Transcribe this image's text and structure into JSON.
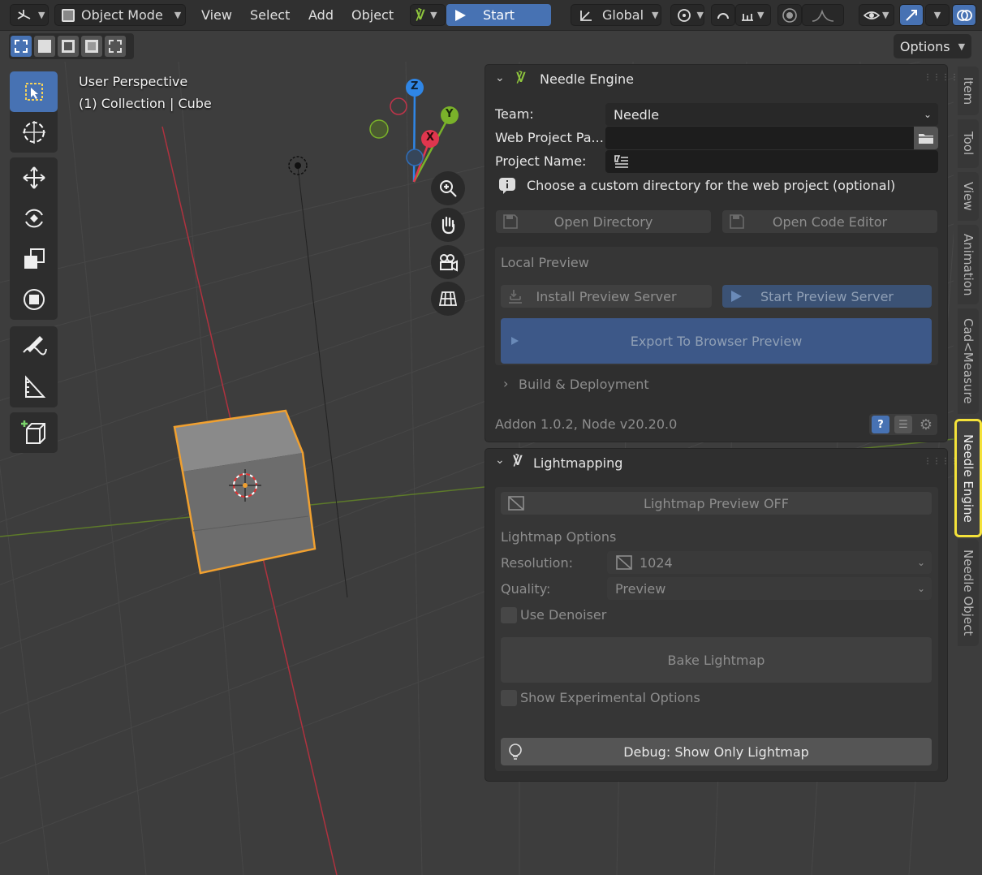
{
  "header": {
    "editor_type_icon": "3d-viewport-icon",
    "mode": "Object Mode",
    "menus": [
      "View",
      "Select",
      "Add",
      "Object"
    ],
    "start_label": "Start",
    "transform_orientation": "Global",
    "options_label": "Options"
  },
  "viewport": {
    "perspective": "User Perspective",
    "collection": "(1) Collection | Cube",
    "axes": {
      "z": "Z",
      "y": "Y",
      "x": "X"
    }
  },
  "needle_engine": {
    "title": "Needle Engine",
    "team_label": "Team:",
    "team_value": "Needle",
    "web_project_label": "Web Project Pa...",
    "web_project_value": "",
    "project_name_label": "Project Name:",
    "project_name_value": "",
    "hint": "Choose a custom directory for the web project (optional)",
    "open_directory": "Open Directory",
    "open_code_editor": "Open Code Editor",
    "local_preview_title": "Local Preview",
    "install_preview_server": "Install Preview Server",
    "start_preview_server": "Start Preview Server",
    "export_to_browser": "Export To Browser Preview",
    "build_deployment": "Build & Deployment",
    "version": "Addon 1.0.2, Node v20.20.0"
  },
  "lightmapping": {
    "title": "Lightmapping",
    "preview_toggle": "Lightmap Preview OFF",
    "options_title": "Lightmap Options",
    "resolution_label": "Resolution:",
    "resolution_value": "1024",
    "quality_label": "Quality:",
    "quality_value": "Preview",
    "use_denoiser": "Use Denoiser",
    "bake": "Bake Lightmap",
    "show_experimental": "Show Experimental Options",
    "debug": "Debug: Show Only Lightmap"
  },
  "sidebar_tabs": [
    "Item",
    "Tool",
    "View",
    "Animation",
    "Cad<Measure",
    "Needle Engine",
    "Needle Object"
  ],
  "active_tab": "Needle Engine",
  "colors": {
    "accent_blue": "#4772b3",
    "highlight_yellow": "#f4e23a",
    "selection_orange": "#f0a030",
    "axis_x": "#e0364e",
    "axis_y": "#7ab22a",
    "axis_z": "#2f86e6"
  }
}
